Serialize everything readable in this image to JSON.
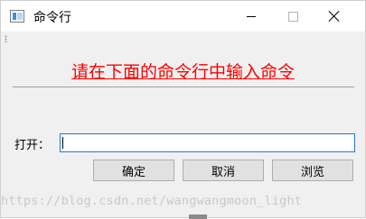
{
  "window": {
    "title": "命令行",
    "icon": "app-window-icon"
  },
  "main": {
    "heading": "请在下面的命令行中输入命令",
    "heading_color": "#ff0000",
    "open_label": "打开：",
    "open_value": "",
    "buttons": {
      "ok": "确定",
      "cancel": "取消",
      "browse": "浏览"
    }
  },
  "watermark": "https://blog.csdn.net/wangwangmoon_light"
}
